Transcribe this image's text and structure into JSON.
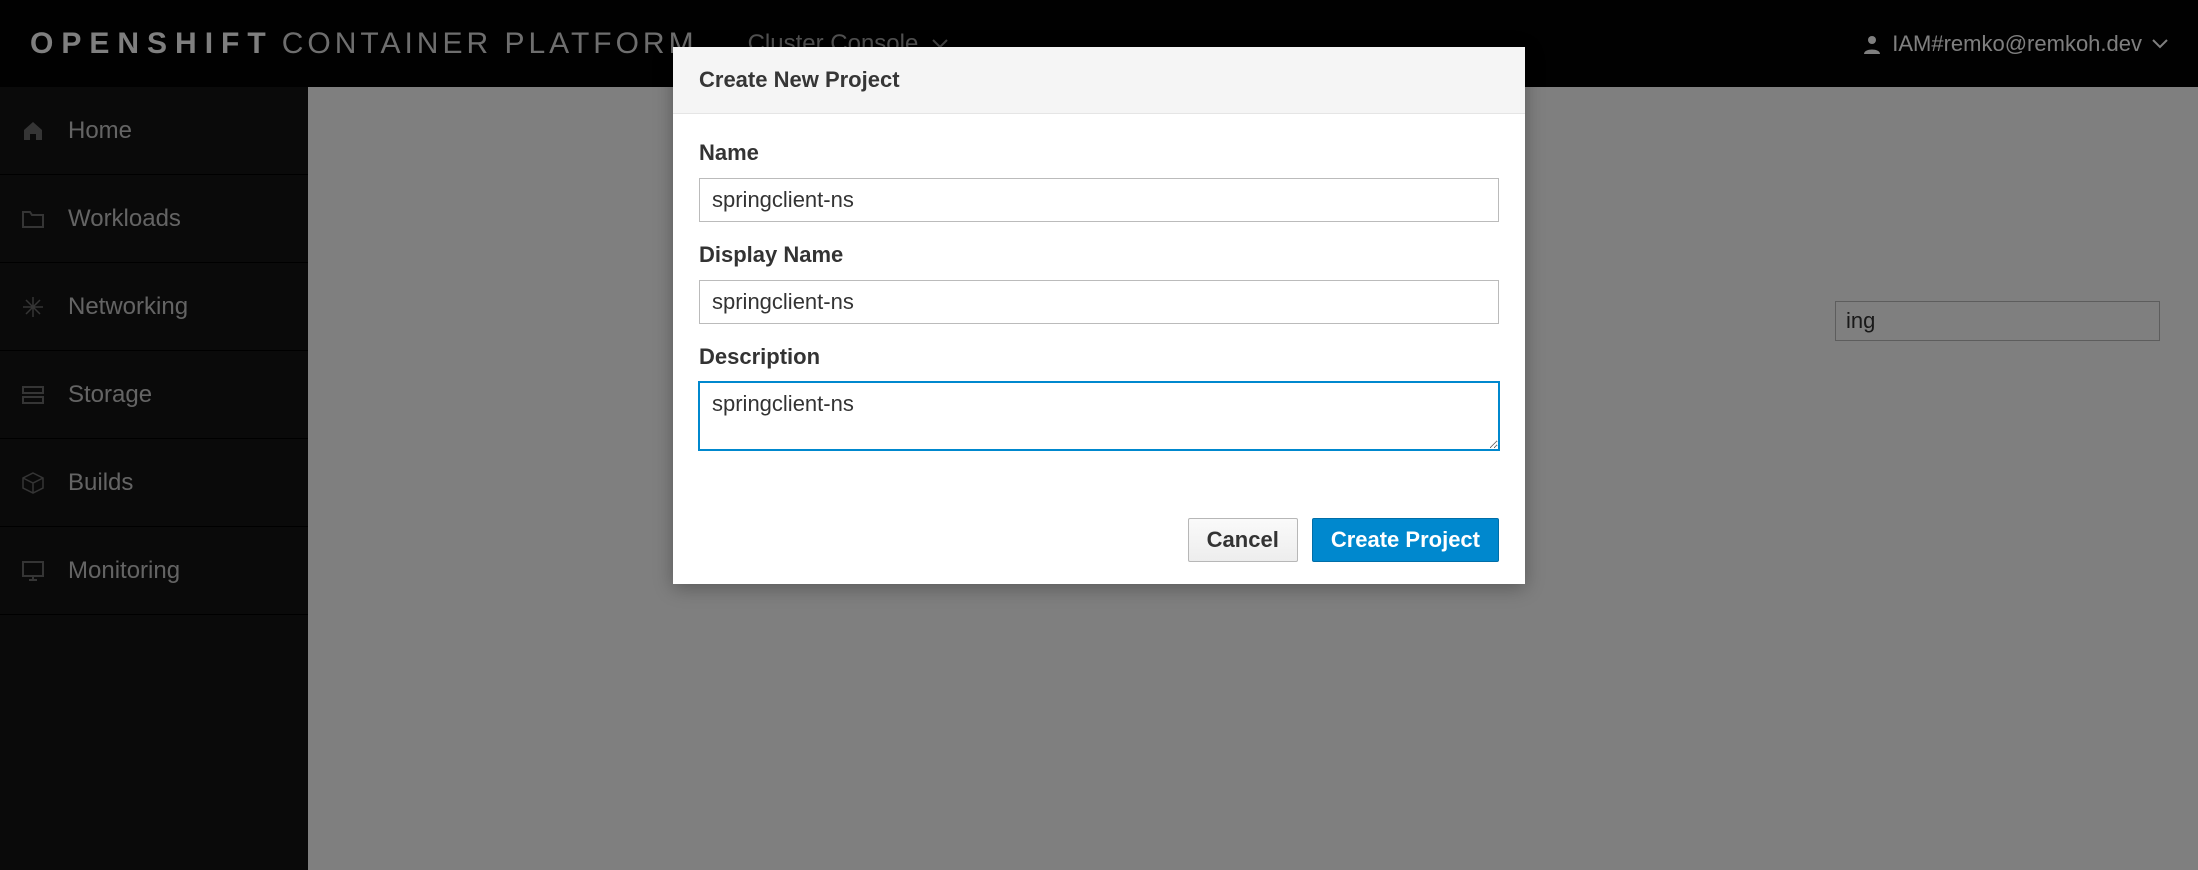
{
  "header": {
    "brand_bold": "OPENSHIFT",
    "brand_light": "CONTAINER PLATFORM",
    "console_switch": "Cluster Console",
    "user": "IAM#remko@remkoh.dev"
  },
  "sidebar": {
    "items": [
      {
        "icon": "home-icon",
        "label": "Home"
      },
      {
        "icon": "folder-icon",
        "label": "Workloads"
      },
      {
        "icon": "network-icon",
        "label": "Networking"
      },
      {
        "icon": "storage-icon",
        "label": "Storage"
      },
      {
        "icon": "builds-icon",
        "label": "Builds"
      },
      {
        "icon": "monitor-icon",
        "label": "Monitoring"
      }
    ]
  },
  "background_field_suffix": "ing",
  "modal": {
    "title": "Create New Project",
    "name_label": "Name",
    "name_value": "springclient-ns",
    "display_label": "Display Name",
    "display_value": "springclient-ns",
    "description_label": "Description",
    "description_value": "springclient-ns",
    "cancel": "Cancel",
    "create": "Create Project"
  }
}
